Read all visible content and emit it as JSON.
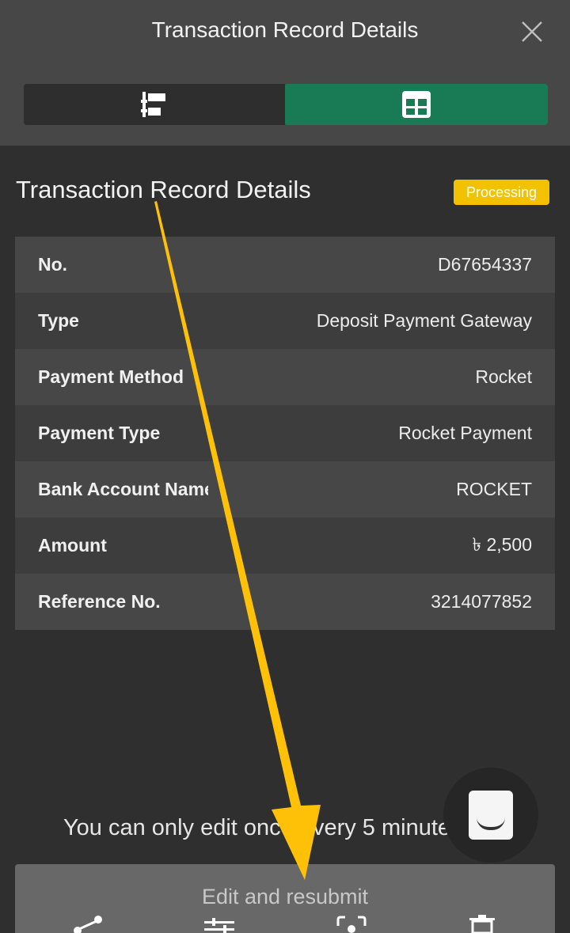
{
  "header": {
    "title": "Transaction Record Details",
    "close_icon": "close-icon"
  },
  "view_toggle": {
    "left_icon": "list-view-icon",
    "right_icon": "grid-view-icon",
    "active": "grid"
  },
  "record": {
    "title": "Transaction Record Details",
    "status": "Processing",
    "status_color": "#f2c200",
    "rows": [
      {
        "label": "No.",
        "value": "D67654337"
      },
      {
        "label": "Type",
        "value": "Deposit Payment Gateway"
      },
      {
        "label": "Payment Method",
        "value": "Rocket"
      },
      {
        "label": "Payment Type",
        "value": "Rocket Payment"
      },
      {
        "label": "Bank Account Name",
        "value": "ROCKET"
      },
      {
        "label": "Amount",
        "value": "৳ 2,500"
      },
      {
        "label": "Reference No.",
        "value": "3214077852"
      }
    ]
  },
  "notice": "You can only edit once every 5 minutes",
  "primary_button": "Edit and resubmit",
  "accent_color": "#197a56",
  "annotation_arrow_color": "#ffc107",
  "bottom_bar": [
    "share-icon",
    "adjust-icon",
    "screenshot-icon",
    "delete-icon"
  ]
}
